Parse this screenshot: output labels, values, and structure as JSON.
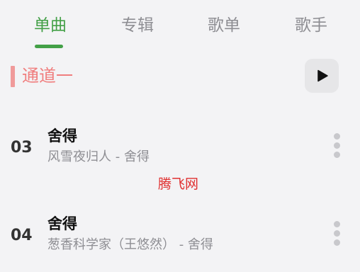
{
  "tabs": [
    {
      "label": "单曲",
      "active": true
    },
    {
      "label": "专辑",
      "active": false
    },
    {
      "label": "歌单",
      "active": false
    },
    {
      "label": "歌手",
      "active": false
    }
  ],
  "section": {
    "title": "通道一",
    "play_icon": "play-icon"
  },
  "tracks": [
    {
      "number": "03",
      "title": "舍得",
      "subtitle": "风雪夜归人 - 舍得",
      "more_icon": "more-vertical-icon"
    },
    {
      "number": "04",
      "title": "舍得",
      "subtitle": "葱香科学家（王悠然） - 舍得",
      "more_icon": "more-vertical-icon"
    }
  ],
  "watermark": "腾飞网",
  "colors": {
    "accent_green": "#43a047",
    "section_pink": "#f07e7e",
    "watermark_red": "#e03030",
    "background": "#f3f3f5"
  }
}
